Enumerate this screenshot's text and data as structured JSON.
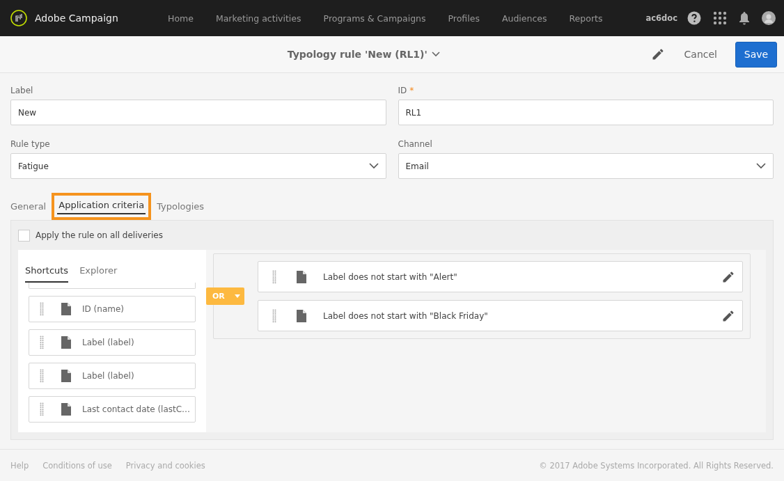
{
  "topbar": {
    "brand": "Adobe Campaign",
    "nav": [
      {
        "label": "Home"
      },
      {
        "label": "Marketing activities"
      },
      {
        "label": "Programs & Campaigns"
      },
      {
        "label": "Profiles"
      },
      {
        "label": "Audiences"
      },
      {
        "label": "Reports"
      }
    ],
    "user": "ac6doc"
  },
  "header": {
    "title": "Typology rule 'New (RL1)'",
    "cancel": "Cancel",
    "save": "Save"
  },
  "fields": [
    {
      "label": "Label",
      "kind": "text",
      "value": "New"
    },
    {
      "label": "ID",
      "required_mark": "*",
      "kind": "text",
      "value": "RL1"
    },
    {
      "label": "Rule type",
      "kind": "select",
      "value": "Fatigue"
    },
    {
      "label": "Channel",
      "kind": "select",
      "value": "Email"
    }
  ],
  "tabs": [
    {
      "label": "General",
      "selected": false,
      "highlighted": false
    },
    {
      "label": "Application criteria",
      "selected": true,
      "highlighted": true
    },
    {
      "label": "Typologies",
      "selected": false,
      "highlighted": false
    }
  ],
  "apply_all": {
    "label": "Apply the rule on all deliveries",
    "checked": false
  },
  "palette": {
    "tabs": [
      {
        "label": "Shortcuts",
        "selected": true
      },
      {
        "label": "Explorer",
        "selected": false
      }
    ],
    "items": [
      {
        "label": "ID (name)"
      },
      {
        "label": "Label (label)"
      },
      {
        "label": "Label (label)"
      },
      {
        "label": "Last contact date (lastC…"
      }
    ]
  },
  "query": {
    "operator": "OR",
    "conditions": [
      {
        "label": "Label does not start with \"Alert\""
      },
      {
        "label": "Label does not start with \"Black Friday\""
      }
    ]
  },
  "footer": {
    "links": [
      "Help",
      "Conditions of use",
      "Privacy and cookies"
    ],
    "copyright": "© 2017 Adobe Systems Incorporated. All Rights Reserved."
  }
}
